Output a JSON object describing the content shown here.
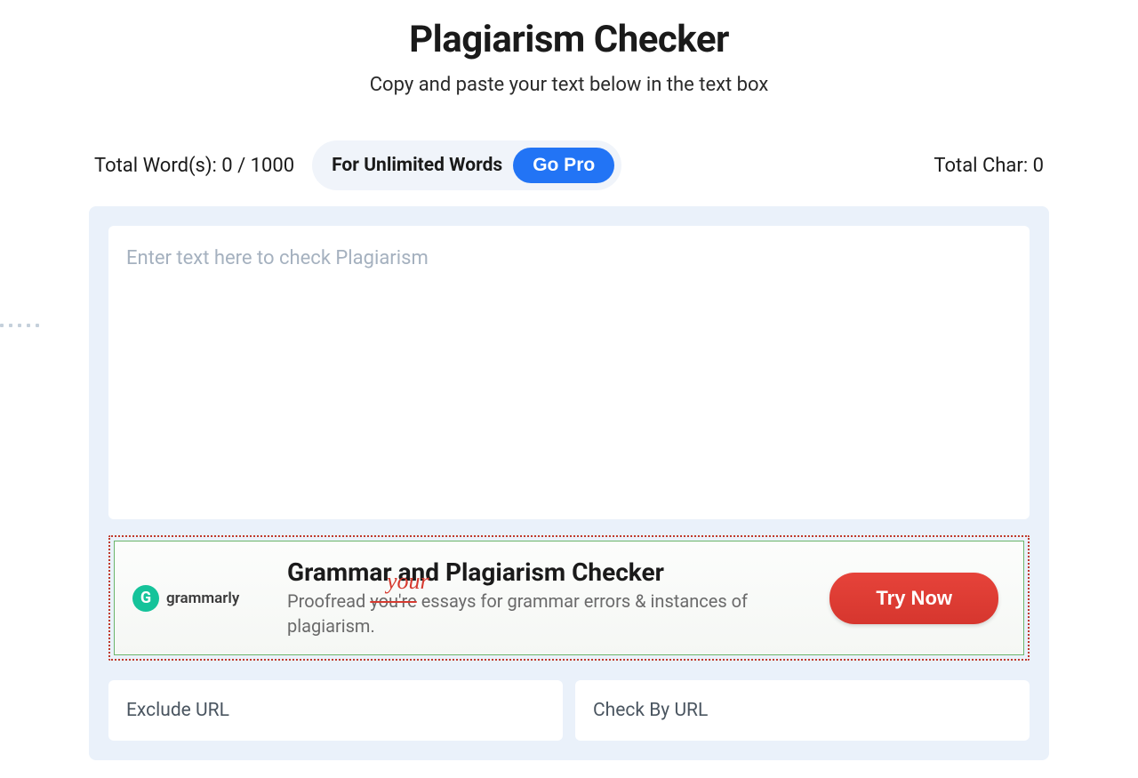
{
  "header": {
    "title": "Plagiarism Checker",
    "subtitle": "Copy and paste your text below in the text box"
  },
  "stats": {
    "word_count_label": "Total Word(s): 0 / 1000",
    "pro_label": "For Unlimited Words",
    "go_pro_label": "Go Pro",
    "char_count_label": "Total Char: 0"
  },
  "editor": {
    "placeholder": "Enter text here to check Plagiarism"
  },
  "ad": {
    "logo_letter": "G",
    "logo_text": "grammarly",
    "title": "Grammar and Plagiarism Checker",
    "desc_prefix": "Proofread ",
    "desc_strike": "you're",
    "desc_suffix": " essays for grammar errors & instances of plagiarism.",
    "handwritten": "your",
    "cta": "Try Now"
  },
  "inputs": {
    "exclude_url_placeholder": "Exclude URL",
    "check_url_placeholder": "Check By URL"
  }
}
